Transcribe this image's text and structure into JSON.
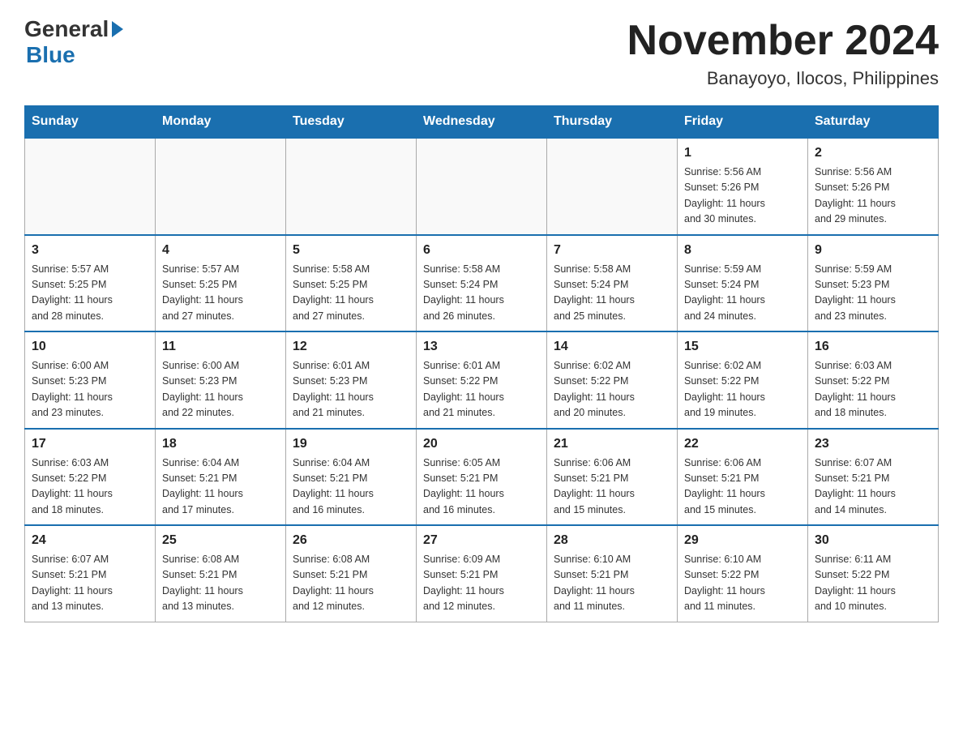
{
  "logo": {
    "general": "General",
    "blue": "Blue"
  },
  "title": "November 2024",
  "subtitle": "Banayoyo, Ilocos, Philippines",
  "days_of_week": [
    "Sunday",
    "Monday",
    "Tuesday",
    "Wednesday",
    "Thursday",
    "Friday",
    "Saturday"
  ],
  "weeks": [
    [
      {
        "day": "",
        "info": ""
      },
      {
        "day": "",
        "info": ""
      },
      {
        "day": "",
        "info": ""
      },
      {
        "day": "",
        "info": ""
      },
      {
        "day": "",
        "info": ""
      },
      {
        "day": "1",
        "info": "Sunrise: 5:56 AM\nSunset: 5:26 PM\nDaylight: 11 hours\nand 30 minutes."
      },
      {
        "day": "2",
        "info": "Sunrise: 5:56 AM\nSunset: 5:26 PM\nDaylight: 11 hours\nand 29 minutes."
      }
    ],
    [
      {
        "day": "3",
        "info": "Sunrise: 5:57 AM\nSunset: 5:25 PM\nDaylight: 11 hours\nand 28 minutes."
      },
      {
        "day": "4",
        "info": "Sunrise: 5:57 AM\nSunset: 5:25 PM\nDaylight: 11 hours\nand 27 minutes."
      },
      {
        "day": "5",
        "info": "Sunrise: 5:58 AM\nSunset: 5:25 PM\nDaylight: 11 hours\nand 27 minutes."
      },
      {
        "day": "6",
        "info": "Sunrise: 5:58 AM\nSunset: 5:24 PM\nDaylight: 11 hours\nand 26 minutes."
      },
      {
        "day": "7",
        "info": "Sunrise: 5:58 AM\nSunset: 5:24 PM\nDaylight: 11 hours\nand 25 minutes."
      },
      {
        "day": "8",
        "info": "Sunrise: 5:59 AM\nSunset: 5:24 PM\nDaylight: 11 hours\nand 24 minutes."
      },
      {
        "day": "9",
        "info": "Sunrise: 5:59 AM\nSunset: 5:23 PM\nDaylight: 11 hours\nand 23 minutes."
      }
    ],
    [
      {
        "day": "10",
        "info": "Sunrise: 6:00 AM\nSunset: 5:23 PM\nDaylight: 11 hours\nand 23 minutes."
      },
      {
        "day": "11",
        "info": "Sunrise: 6:00 AM\nSunset: 5:23 PM\nDaylight: 11 hours\nand 22 minutes."
      },
      {
        "day": "12",
        "info": "Sunrise: 6:01 AM\nSunset: 5:23 PM\nDaylight: 11 hours\nand 21 minutes."
      },
      {
        "day": "13",
        "info": "Sunrise: 6:01 AM\nSunset: 5:22 PM\nDaylight: 11 hours\nand 21 minutes."
      },
      {
        "day": "14",
        "info": "Sunrise: 6:02 AM\nSunset: 5:22 PM\nDaylight: 11 hours\nand 20 minutes."
      },
      {
        "day": "15",
        "info": "Sunrise: 6:02 AM\nSunset: 5:22 PM\nDaylight: 11 hours\nand 19 minutes."
      },
      {
        "day": "16",
        "info": "Sunrise: 6:03 AM\nSunset: 5:22 PM\nDaylight: 11 hours\nand 18 minutes."
      }
    ],
    [
      {
        "day": "17",
        "info": "Sunrise: 6:03 AM\nSunset: 5:22 PM\nDaylight: 11 hours\nand 18 minutes."
      },
      {
        "day": "18",
        "info": "Sunrise: 6:04 AM\nSunset: 5:21 PM\nDaylight: 11 hours\nand 17 minutes."
      },
      {
        "day": "19",
        "info": "Sunrise: 6:04 AM\nSunset: 5:21 PM\nDaylight: 11 hours\nand 16 minutes."
      },
      {
        "day": "20",
        "info": "Sunrise: 6:05 AM\nSunset: 5:21 PM\nDaylight: 11 hours\nand 16 minutes."
      },
      {
        "day": "21",
        "info": "Sunrise: 6:06 AM\nSunset: 5:21 PM\nDaylight: 11 hours\nand 15 minutes."
      },
      {
        "day": "22",
        "info": "Sunrise: 6:06 AM\nSunset: 5:21 PM\nDaylight: 11 hours\nand 15 minutes."
      },
      {
        "day": "23",
        "info": "Sunrise: 6:07 AM\nSunset: 5:21 PM\nDaylight: 11 hours\nand 14 minutes."
      }
    ],
    [
      {
        "day": "24",
        "info": "Sunrise: 6:07 AM\nSunset: 5:21 PM\nDaylight: 11 hours\nand 13 minutes."
      },
      {
        "day": "25",
        "info": "Sunrise: 6:08 AM\nSunset: 5:21 PM\nDaylight: 11 hours\nand 13 minutes."
      },
      {
        "day": "26",
        "info": "Sunrise: 6:08 AM\nSunset: 5:21 PM\nDaylight: 11 hours\nand 12 minutes."
      },
      {
        "day": "27",
        "info": "Sunrise: 6:09 AM\nSunset: 5:21 PM\nDaylight: 11 hours\nand 12 minutes."
      },
      {
        "day": "28",
        "info": "Sunrise: 6:10 AM\nSunset: 5:21 PM\nDaylight: 11 hours\nand 11 minutes."
      },
      {
        "day": "29",
        "info": "Sunrise: 6:10 AM\nSunset: 5:22 PM\nDaylight: 11 hours\nand 11 minutes."
      },
      {
        "day": "30",
        "info": "Sunrise: 6:11 AM\nSunset: 5:22 PM\nDaylight: 11 hours\nand 10 minutes."
      }
    ]
  ]
}
